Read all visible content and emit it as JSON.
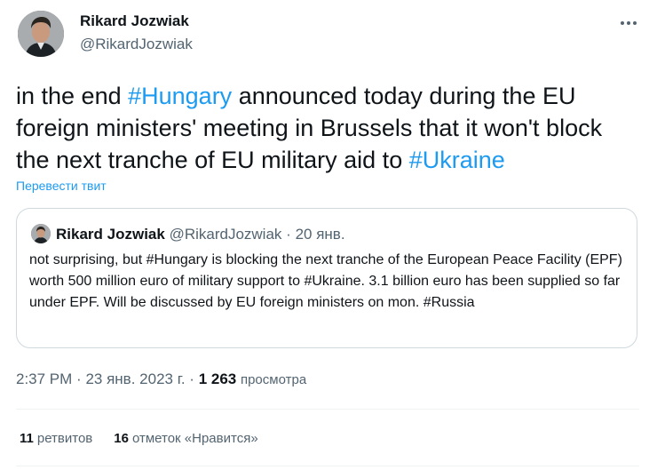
{
  "author": {
    "name": "Rikard Jozwiak",
    "handle": "@RikardJozwiak"
  },
  "tweet": {
    "text_before_h1": "in the end ",
    "hashtag1": "#Hungary",
    "text_between": " announced today during the EU foreign ministers' meeting in Brussels that it won't block the next tranche of EU military aid to ",
    "hashtag2": "#Ukraine",
    "translate_label": "Перевести твит"
  },
  "quote": {
    "name": "Rikard Jozwiak",
    "handle": "@RikardJozwiak",
    "separator": "·",
    "date": "20 янв.",
    "text": "not surprising, but #Hungary is blocking the next tranche of the European Peace Facility (EPF) worth 500 million euro of military support to #Ukraine. 3.1 billion euro has been supplied so far under EPF. Will be discussed by EU foreign ministers on mon. #Russia"
  },
  "meta": {
    "time": "2:37 PM",
    "separator": "·",
    "date": "23 янв. 2023 г.",
    "separator2": "·",
    "views_count": "1 263",
    "views_label": "просмотра"
  },
  "stats": {
    "retweets_count": "11",
    "retweets_label": "ретвитов",
    "likes_count": "16",
    "likes_label": "отметок «Нравится»"
  },
  "icons": {
    "more": "more-horizontal-icon"
  },
  "colors": {
    "accent": "#1d9bf0",
    "text": "#0f1419",
    "secondary": "#536471",
    "border": "#cfd9de"
  }
}
